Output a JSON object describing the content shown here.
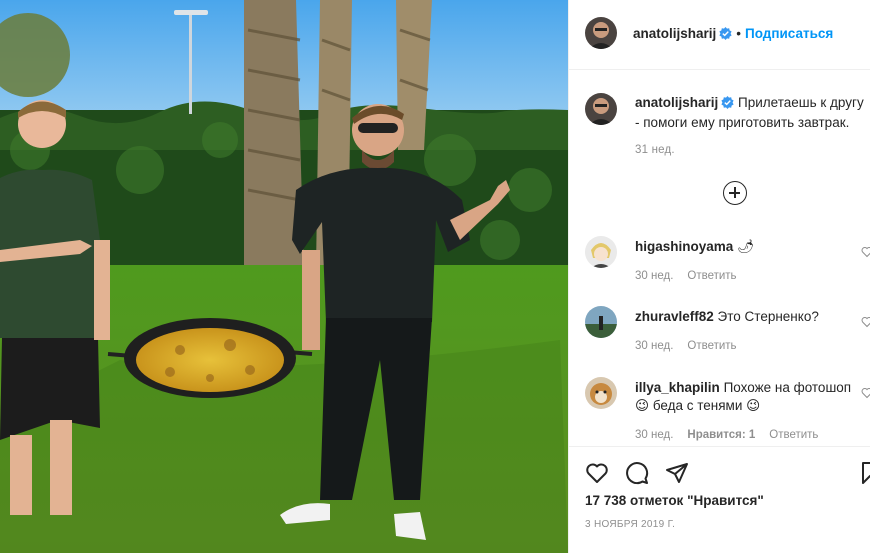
{
  "post": {
    "author": "anatolijsharij",
    "follow_label": "Подписаться",
    "separator": "•",
    "caption_author": "anatolijsharij",
    "caption_text": "Прилетаешь к другу - помоги ему приготовить завтрак.",
    "caption_time": "31 нед.",
    "likes": "17 738 отметок \"Нравится\"",
    "date": "3 НОЯБРЯ 2019 Г."
  },
  "comments": [
    {
      "user": "higashinoyama",
      "text": "🌶",
      "time": "30 нед.",
      "likes": "",
      "reply": "Ответить"
    },
    {
      "user": "zhuravleff82",
      "text": "Это Стерненко?",
      "time": "30 нед.",
      "likes": "",
      "reply": "Ответить"
    },
    {
      "user": "illya_khapilin",
      "text": "Похоже на фотошоп😉 беда с тенями 😉",
      "time": "30 нед.",
      "likes": "Нравится: 1",
      "reply": "Ответить"
    }
  ],
  "icons": {
    "verified": "verified-badge-icon",
    "like": "heart-icon",
    "comment": "comment-icon",
    "share": "share-icon",
    "save": "bookmark-icon",
    "more_comments": "plus-circle-icon"
  },
  "colors": {
    "accent": "#0095f6",
    "text": "#262626",
    "muted": "#8e8e8e",
    "border": "#efefef"
  }
}
